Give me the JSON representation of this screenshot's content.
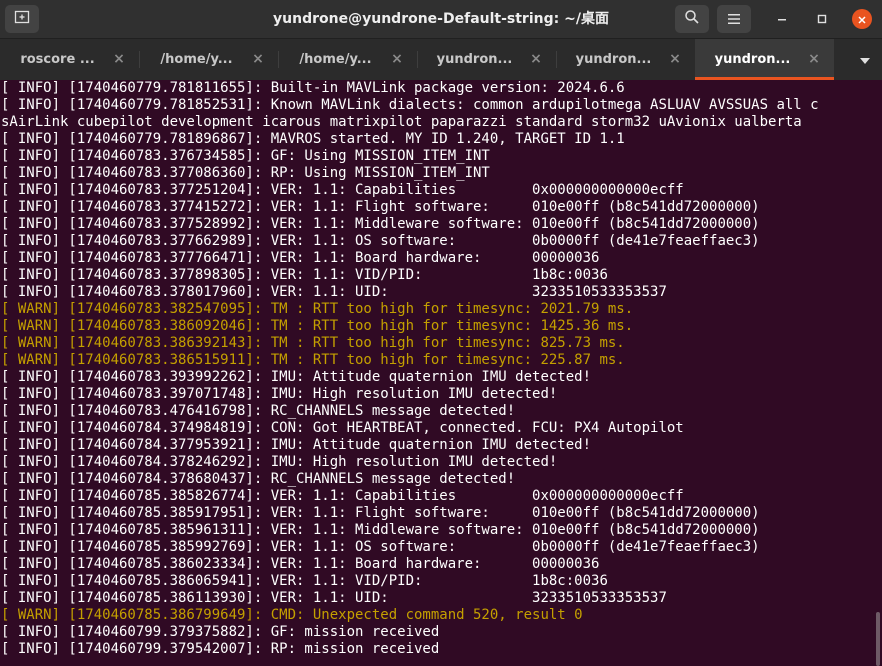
{
  "window": {
    "title": "yundrone@yundrone-Default-string: ~/桌面"
  },
  "titlebar_icons": {
    "new_tab": "new-tab-icon",
    "search": "search-icon",
    "menu": "hamburger-menu-icon",
    "minimize": "minimize-icon",
    "maximize": "maximize-icon",
    "close": "close-icon"
  },
  "tabs": [
    {
      "label": "roscore ...",
      "close": "×"
    },
    {
      "label": "/home/y...",
      "close": "×"
    },
    {
      "label": "/home/y...",
      "close": "×"
    },
    {
      "label": "yundron...",
      "close": "×"
    },
    {
      "label": "yundron...",
      "close": "×"
    },
    {
      "label": "yundron...",
      "close": "×",
      "active": true
    }
  ],
  "colors": {
    "background": "#300a24",
    "info_text": "#ffffff",
    "warn_text": "#c4a000",
    "accent": "#e95420"
  },
  "terminal": {
    "lines": [
      {
        "level": "info",
        "text": "[ INFO] [1740460779.781811655]: Built-in MAVLink package version: 2024.6.6"
      },
      {
        "level": "info",
        "text": "[ INFO] [1740460779.781852531]: Known MAVLink dialects: common ardupilotmega ASLUAV AVSSUAS all c"
      },
      {
        "level": "info",
        "text": "sAirLink cubepilot development icarous matrixpilot paparazzi standard storm32 uAvionix ualberta"
      },
      {
        "level": "info",
        "text": "[ INFO] [1740460779.781896867]: MAVROS started. MY ID 1.240, TARGET ID 1.1"
      },
      {
        "level": "info",
        "text": "[ INFO] [1740460783.376734585]: GF: Using MISSION_ITEM_INT"
      },
      {
        "level": "info",
        "text": "[ INFO] [1740460783.377086360]: RP: Using MISSION_ITEM_INT"
      },
      {
        "level": "info",
        "text": "[ INFO] [1740460783.377251204]: VER: 1.1: Capabilities         0x000000000000ecff"
      },
      {
        "level": "info",
        "text": "[ INFO] [1740460783.377415272]: VER: 1.1: Flight software:     010e00ff (b8c541dd72000000)"
      },
      {
        "level": "info",
        "text": "[ INFO] [1740460783.377528992]: VER: 1.1: Middleware software: 010e00ff (b8c541dd72000000)"
      },
      {
        "level": "info",
        "text": "[ INFO] [1740460783.377662989]: VER: 1.1: OS software:         0b0000ff (de41e7feaeffaec3)"
      },
      {
        "level": "info",
        "text": "[ INFO] [1740460783.377766471]: VER: 1.1: Board hardware:      00000036"
      },
      {
        "level": "info",
        "text": "[ INFO] [1740460783.377898305]: VER: 1.1: VID/PID:             1b8c:0036"
      },
      {
        "level": "info",
        "text": "[ INFO] [1740460783.378017960]: VER: 1.1: UID:                 3233510533353537"
      },
      {
        "level": "warn",
        "text": "[ WARN] [1740460783.382547095]: TM : RTT too high for timesync: 2021.79 ms."
      },
      {
        "level": "warn",
        "text": "[ WARN] [1740460783.386092046]: TM : RTT too high for timesync: 1425.36 ms."
      },
      {
        "level": "warn",
        "text": "[ WARN] [1740460783.386392143]: TM : RTT too high for timesync: 825.73 ms."
      },
      {
        "level": "warn",
        "text": "[ WARN] [1740460783.386515911]: TM : RTT too high for timesync: 225.87 ms."
      },
      {
        "level": "info",
        "text": "[ INFO] [1740460783.393992262]: IMU: Attitude quaternion IMU detected!"
      },
      {
        "level": "info",
        "text": "[ INFO] [1740460783.397071748]: IMU: High resolution IMU detected!"
      },
      {
        "level": "info",
        "text": "[ INFO] [1740460783.476416798]: RC_CHANNELS message detected!"
      },
      {
        "level": "info",
        "text": "[ INFO] [1740460784.374984819]: CON: Got HEARTBEAT, connected. FCU: PX4 Autopilot"
      },
      {
        "level": "info",
        "text": "[ INFO] [1740460784.377953921]: IMU: Attitude quaternion IMU detected!"
      },
      {
        "level": "info",
        "text": "[ INFO] [1740460784.378246292]: IMU: High resolution IMU detected!"
      },
      {
        "level": "info",
        "text": "[ INFO] [1740460784.378680437]: RC_CHANNELS message detected!"
      },
      {
        "level": "info",
        "text": "[ INFO] [1740460785.385826774]: VER: 1.1: Capabilities         0x000000000000ecff"
      },
      {
        "level": "info",
        "text": "[ INFO] [1740460785.385917951]: VER: 1.1: Flight software:     010e00ff (b8c541dd72000000)"
      },
      {
        "level": "info",
        "text": "[ INFO] [1740460785.385961311]: VER: 1.1: Middleware software: 010e00ff (b8c541dd72000000)"
      },
      {
        "level": "info",
        "text": "[ INFO] [1740460785.385992769]: VER: 1.1: OS software:         0b0000ff (de41e7feaeffaec3)"
      },
      {
        "level": "info",
        "text": "[ INFO] [1740460785.386023334]: VER: 1.1: Board hardware:      00000036"
      },
      {
        "level": "info",
        "text": "[ INFO] [1740460785.386065941]: VER: 1.1: VID/PID:             1b8c:0036"
      },
      {
        "level": "info",
        "text": "[ INFO] [1740460785.386113930]: VER: 1.1: UID:                 3233510533353537"
      },
      {
        "level": "warn",
        "text": "[ WARN] [1740460785.386799649]: CMD: Unexpected command 520, result 0"
      },
      {
        "level": "info",
        "text": "[ INFO] [1740460799.379375882]: GF: mission received"
      },
      {
        "level": "info",
        "text": "[ INFO] [1740460799.379542007]: RP: mission received"
      }
    ]
  }
}
